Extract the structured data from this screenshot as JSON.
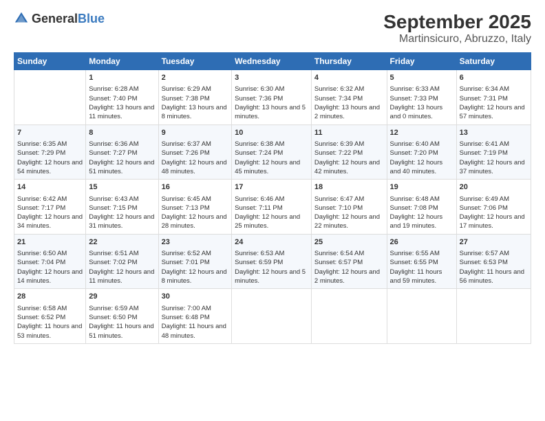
{
  "logo": {
    "text_general": "General",
    "text_blue": "Blue"
  },
  "title": "September 2025",
  "subtitle": "Martinsicuro, Abruzzo, Italy",
  "days_of_week": [
    "Sunday",
    "Monday",
    "Tuesday",
    "Wednesday",
    "Thursday",
    "Friday",
    "Saturday"
  ],
  "weeks": [
    [
      {
        "day": "",
        "sunrise": "",
        "sunset": "",
        "daylight": ""
      },
      {
        "day": "1",
        "sunrise": "Sunrise: 6:28 AM",
        "sunset": "Sunset: 7:40 PM",
        "daylight": "Daylight: 13 hours and 11 minutes."
      },
      {
        "day": "2",
        "sunrise": "Sunrise: 6:29 AM",
        "sunset": "Sunset: 7:38 PM",
        "daylight": "Daylight: 13 hours and 8 minutes."
      },
      {
        "day": "3",
        "sunrise": "Sunrise: 6:30 AM",
        "sunset": "Sunset: 7:36 PM",
        "daylight": "Daylight: 13 hours and 5 minutes."
      },
      {
        "day": "4",
        "sunrise": "Sunrise: 6:32 AM",
        "sunset": "Sunset: 7:34 PM",
        "daylight": "Daylight: 13 hours and 2 minutes."
      },
      {
        "day": "5",
        "sunrise": "Sunrise: 6:33 AM",
        "sunset": "Sunset: 7:33 PM",
        "daylight": "Daylight: 13 hours and 0 minutes."
      },
      {
        "day": "6",
        "sunrise": "Sunrise: 6:34 AM",
        "sunset": "Sunset: 7:31 PM",
        "daylight": "Daylight: 12 hours and 57 minutes."
      }
    ],
    [
      {
        "day": "7",
        "sunrise": "Sunrise: 6:35 AM",
        "sunset": "Sunset: 7:29 PM",
        "daylight": "Daylight: 12 hours and 54 minutes."
      },
      {
        "day": "8",
        "sunrise": "Sunrise: 6:36 AM",
        "sunset": "Sunset: 7:27 PM",
        "daylight": "Daylight: 12 hours and 51 minutes."
      },
      {
        "day": "9",
        "sunrise": "Sunrise: 6:37 AM",
        "sunset": "Sunset: 7:26 PM",
        "daylight": "Daylight: 12 hours and 48 minutes."
      },
      {
        "day": "10",
        "sunrise": "Sunrise: 6:38 AM",
        "sunset": "Sunset: 7:24 PM",
        "daylight": "Daylight: 12 hours and 45 minutes."
      },
      {
        "day": "11",
        "sunrise": "Sunrise: 6:39 AM",
        "sunset": "Sunset: 7:22 PM",
        "daylight": "Daylight: 12 hours and 42 minutes."
      },
      {
        "day": "12",
        "sunrise": "Sunrise: 6:40 AM",
        "sunset": "Sunset: 7:20 PM",
        "daylight": "Daylight: 12 hours and 40 minutes."
      },
      {
        "day": "13",
        "sunrise": "Sunrise: 6:41 AM",
        "sunset": "Sunset: 7:19 PM",
        "daylight": "Daylight: 12 hours and 37 minutes."
      }
    ],
    [
      {
        "day": "14",
        "sunrise": "Sunrise: 6:42 AM",
        "sunset": "Sunset: 7:17 PM",
        "daylight": "Daylight: 12 hours and 34 minutes."
      },
      {
        "day": "15",
        "sunrise": "Sunrise: 6:43 AM",
        "sunset": "Sunset: 7:15 PM",
        "daylight": "Daylight: 12 hours and 31 minutes."
      },
      {
        "day": "16",
        "sunrise": "Sunrise: 6:45 AM",
        "sunset": "Sunset: 7:13 PM",
        "daylight": "Daylight: 12 hours and 28 minutes."
      },
      {
        "day": "17",
        "sunrise": "Sunrise: 6:46 AM",
        "sunset": "Sunset: 7:11 PM",
        "daylight": "Daylight: 12 hours and 25 minutes."
      },
      {
        "day": "18",
        "sunrise": "Sunrise: 6:47 AM",
        "sunset": "Sunset: 7:10 PM",
        "daylight": "Daylight: 12 hours and 22 minutes."
      },
      {
        "day": "19",
        "sunrise": "Sunrise: 6:48 AM",
        "sunset": "Sunset: 7:08 PM",
        "daylight": "Daylight: 12 hours and 19 minutes."
      },
      {
        "day": "20",
        "sunrise": "Sunrise: 6:49 AM",
        "sunset": "Sunset: 7:06 PM",
        "daylight": "Daylight: 12 hours and 17 minutes."
      }
    ],
    [
      {
        "day": "21",
        "sunrise": "Sunrise: 6:50 AM",
        "sunset": "Sunset: 7:04 PM",
        "daylight": "Daylight: 12 hours and 14 minutes."
      },
      {
        "day": "22",
        "sunrise": "Sunrise: 6:51 AM",
        "sunset": "Sunset: 7:02 PM",
        "daylight": "Daylight: 12 hours and 11 minutes."
      },
      {
        "day": "23",
        "sunrise": "Sunrise: 6:52 AM",
        "sunset": "Sunset: 7:01 PM",
        "daylight": "Daylight: 12 hours and 8 minutes."
      },
      {
        "day": "24",
        "sunrise": "Sunrise: 6:53 AM",
        "sunset": "Sunset: 6:59 PM",
        "daylight": "Daylight: 12 hours and 5 minutes."
      },
      {
        "day": "25",
        "sunrise": "Sunrise: 6:54 AM",
        "sunset": "Sunset: 6:57 PM",
        "daylight": "Daylight: 12 hours and 2 minutes."
      },
      {
        "day": "26",
        "sunrise": "Sunrise: 6:55 AM",
        "sunset": "Sunset: 6:55 PM",
        "daylight": "Daylight: 11 hours and 59 minutes."
      },
      {
        "day": "27",
        "sunrise": "Sunrise: 6:57 AM",
        "sunset": "Sunset: 6:53 PM",
        "daylight": "Daylight: 11 hours and 56 minutes."
      }
    ],
    [
      {
        "day": "28",
        "sunrise": "Sunrise: 6:58 AM",
        "sunset": "Sunset: 6:52 PM",
        "daylight": "Daylight: 11 hours and 53 minutes."
      },
      {
        "day": "29",
        "sunrise": "Sunrise: 6:59 AM",
        "sunset": "Sunset: 6:50 PM",
        "daylight": "Daylight: 11 hours and 51 minutes."
      },
      {
        "day": "30",
        "sunrise": "Sunrise: 7:00 AM",
        "sunset": "Sunset: 6:48 PM",
        "daylight": "Daylight: 11 hours and 48 minutes."
      },
      {
        "day": "",
        "sunrise": "",
        "sunset": "",
        "daylight": ""
      },
      {
        "day": "",
        "sunrise": "",
        "sunset": "",
        "daylight": ""
      },
      {
        "day": "",
        "sunrise": "",
        "sunset": "",
        "daylight": ""
      },
      {
        "day": "",
        "sunrise": "",
        "sunset": "",
        "daylight": ""
      }
    ]
  ]
}
